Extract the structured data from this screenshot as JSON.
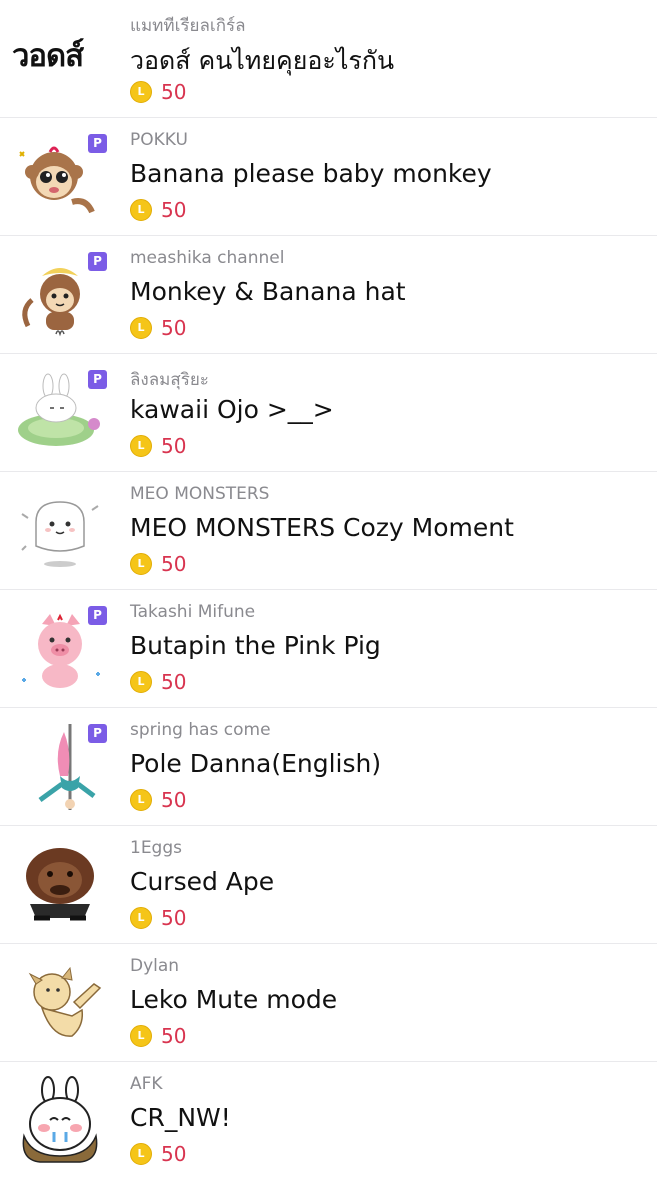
{
  "stickers": [
    {
      "author": "แมททีเรียลเกิร์ล",
      "title": "วอดส์ คนไทยคุยอะไรกัน",
      "price": "50",
      "premium": false,
      "thumb_text": "วอดส์",
      "thumb": "thai-text-logo"
    },
    {
      "author": "POKKU",
      "title": "Banana please baby monkey",
      "price": "50",
      "premium": true,
      "thumb": "baby-monkey-icon"
    },
    {
      "author": "meashika channel",
      "title": "Monkey & Banana hat",
      "price": "50",
      "premium": true,
      "thumb": "monkey-banana-hat-icon"
    },
    {
      "author": "ลิงลมสุริยะ",
      "title": "kawaii Ojo >__>",
      "price": "50",
      "premium": true,
      "thumb": "bunny-lilypad-icon"
    },
    {
      "author": "MEO MONSTERS",
      "title": "MEO MONSTERS Cozy Moment",
      "price": "50",
      "premium": false,
      "thumb": "white-monster-icon"
    },
    {
      "author": "Takashi Mifune",
      "title": "Butapin the Pink Pig",
      "price": "50",
      "premium": true,
      "thumb": "pink-pig-icon"
    },
    {
      "author": "spring has come",
      "title": "Pole Danna(English)",
      "price": "50",
      "premium": true,
      "thumb": "pole-dancer-icon"
    },
    {
      "author": "1Eggs",
      "title": "Cursed Ape",
      "price": "50",
      "premium": false,
      "thumb": "ape-face-icon"
    },
    {
      "author": "Dylan",
      "title": "Leko Mute mode",
      "price": "50",
      "premium": false,
      "thumb": "dog-icon"
    },
    {
      "author": "AFK",
      "title": "CR_NW!",
      "price": "50",
      "premium": false,
      "thumb": "bunny-crying-icon"
    }
  ],
  "premium_badge": "P",
  "colors": {
    "price": "#d8344f",
    "coin": "#f5c518",
    "badge": "#7b5ce6",
    "author": "#8a8a8f"
  }
}
